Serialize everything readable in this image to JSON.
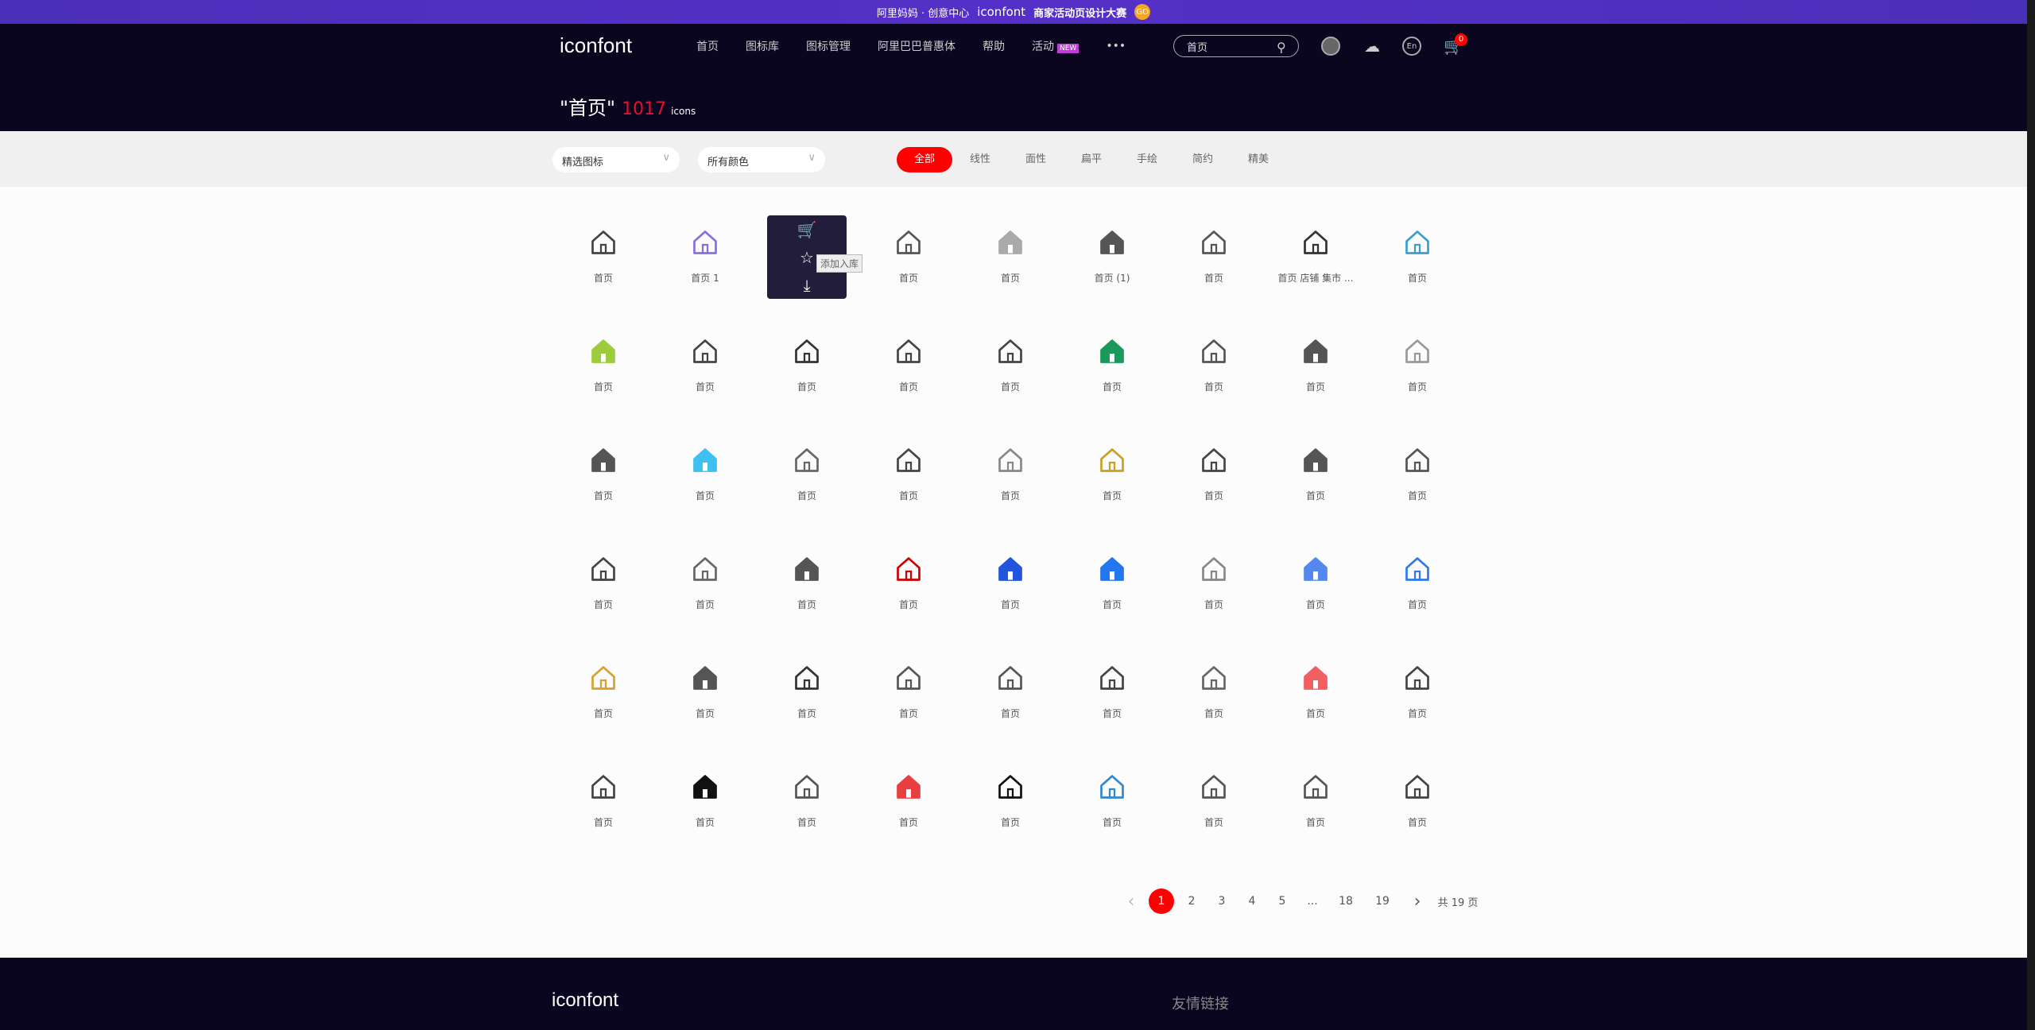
{
  "banner": {
    "brand": "阿里妈妈 · 创意中心",
    "logo": "iconfont",
    "promo": "商家活动页设计大赛",
    "go": "GO"
  },
  "nav": {
    "logo": "iconfont",
    "items": [
      "首页",
      "图标库",
      "图标管理",
      "阿里巴巴普惠体",
      "帮助",
      "活动"
    ],
    "new_badge": "NEW",
    "more": "•••",
    "search_value": "首页",
    "lang": "En",
    "cart_count": "0"
  },
  "heading": {
    "query": "\"首页\"",
    "count": "1017",
    "unit": "icons"
  },
  "filters": {
    "select1": "精选图标",
    "select2": "所有颜色",
    "tabs": [
      "全部",
      "线性",
      "面性",
      "扁平",
      "手绘",
      "简约",
      "精美"
    ],
    "active_tab": "全部"
  },
  "hover_card": {
    "tooltip": "添加入库"
  },
  "icons": [
    {
      "label": "首页",
      "color": "#444"
    },
    {
      "label": "首页 1",
      "color": "#8a6ee0"
    },
    {
      "label": "",
      "color": "#444"
    },
    {
      "label": "首页",
      "color": "#555"
    },
    {
      "label": "首页",
      "color": "#aaa",
      "fill": true
    },
    {
      "label": "首页 (1)",
      "color": "#555",
      "fill": true
    },
    {
      "label": "首页",
      "color": "#555"
    },
    {
      "label": "首页 店铺 集市 ...",
      "color": "#333"
    },
    {
      "label": "首页",
      "color": "#3aa0c8"
    },
    {
      "label": "首页",
      "color": "#9ccc3c",
      "fill": true
    },
    {
      "label": "首页",
      "color": "#444"
    },
    {
      "label": "首页",
      "color": "#333"
    },
    {
      "label": "首页",
      "color": "#444"
    },
    {
      "label": "首页",
      "color": "#444"
    },
    {
      "label": "首页",
      "color": "#1a9a5a",
      "fill": true
    },
    {
      "label": "首页",
      "color": "#555"
    },
    {
      "label": "首页",
      "color": "#555",
      "fill": true
    },
    {
      "label": "首页",
      "color": "#999"
    },
    {
      "label": "首页",
      "color": "#555",
      "fill": true
    },
    {
      "label": "首页",
      "color": "#3ec0f0",
      "fill": true
    },
    {
      "label": "首页",
      "color": "#666"
    },
    {
      "label": "首页",
      "color": "#444"
    },
    {
      "label": "首页",
      "color": "#888"
    },
    {
      "label": "首页",
      "color": "#c8a020"
    },
    {
      "label": "首页",
      "color": "#444"
    },
    {
      "label": "首页",
      "color": "#555",
      "fill": true
    },
    {
      "label": "首页",
      "color": "#555"
    },
    {
      "label": "首页",
      "color": "#444"
    },
    {
      "label": "首页",
      "color": "#666"
    },
    {
      "label": "首页",
      "color": "#555",
      "fill": true
    },
    {
      "label": "首页",
      "color": "#c00"
    },
    {
      "label": "首页",
      "color": "#2255dd",
      "fill": true
    },
    {
      "label": "首页",
      "color": "#2277ee",
      "fill": true
    },
    {
      "label": "首页",
      "color": "#888"
    },
    {
      "label": "首页",
      "color": "#5588ee",
      "fill": true
    },
    {
      "label": "首页",
      "color": "#3377ee"
    },
    {
      "label": "首页",
      "color": "#d8a030"
    },
    {
      "label": "首页",
      "color": "#555",
      "fill": true
    },
    {
      "label": "首页",
      "color": "#333"
    },
    {
      "label": "首页",
      "color": "#555"
    },
    {
      "label": "首页",
      "color": "#555"
    },
    {
      "label": "首页",
      "color": "#444"
    },
    {
      "label": "首页",
      "color": "#666"
    },
    {
      "label": "首页",
      "color": "#f06060",
      "fill": true
    },
    {
      "label": "首页",
      "color": "#444"
    },
    {
      "label": "首页",
      "color": "#444"
    },
    {
      "label": "首页",
      "color": "#111",
      "fill": true
    },
    {
      "label": "首页",
      "color": "#555"
    },
    {
      "label": "首页",
      "color": "#e84040",
      "fill": true
    },
    {
      "label": "首页",
      "color": "#111"
    },
    {
      "label": "首页",
      "color": "#3388cc"
    },
    {
      "label": "首页",
      "color": "#555"
    },
    {
      "label": "首页",
      "color": "#555"
    },
    {
      "label": "首页",
      "color": "#444"
    }
  ],
  "pagination": {
    "prev": "‹",
    "pages": [
      "1",
      "2",
      "3",
      "4",
      "5",
      "...",
      "18",
      "19"
    ],
    "current": "1",
    "next": "›",
    "total": "共 19 页"
  },
  "footer": {
    "logo": "iconfont",
    "links_title": "友情链接"
  }
}
